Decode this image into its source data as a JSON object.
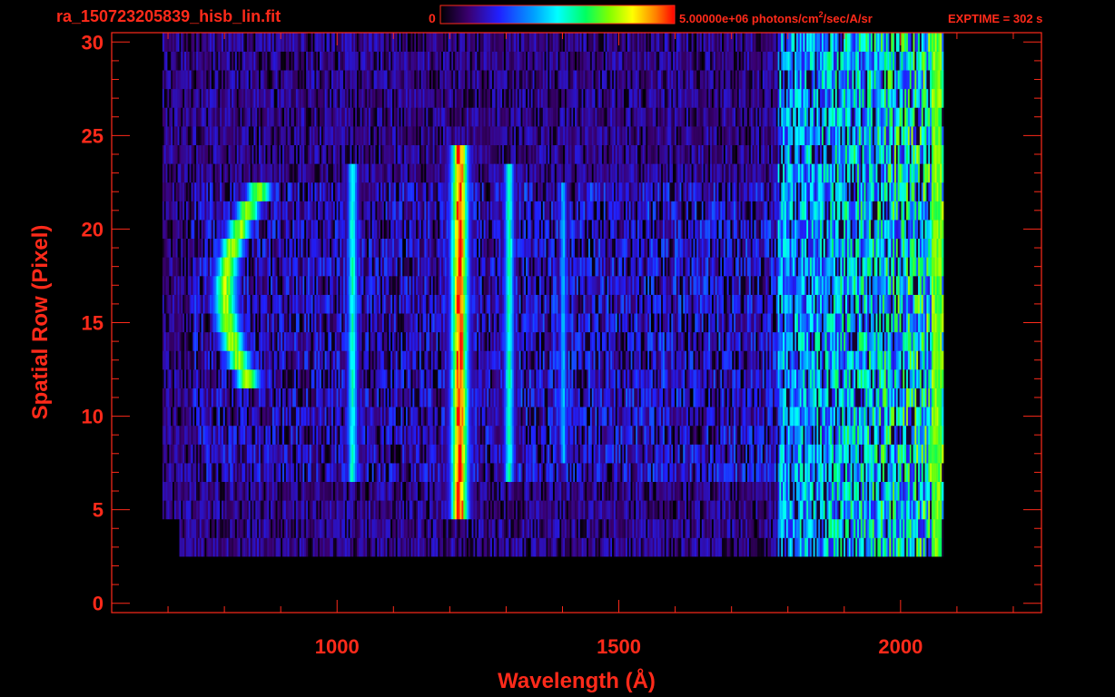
{
  "header": {
    "filename": "ra_150723205839_hisb_lin.fit",
    "colorbar_min": "0",
    "colorbar_max_label": "5.00000e+06 photons/cm",
    "colorbar_sup": "2",
    "colorbar_units_rest": "/sec/A/sr",
    "exptime": "EXPTIME = 302 s"
  },
  "colors": {
    "text": "#ff2a1a",
    "background": "#000000",
    "colormap": [
      "#000000",
      "#3a0070",
      "#2020ff",
      "#00a0ff",
      "#00ffff",
      "#00ff60",
      "#80ff00",
      "#ffff00",
      "#ff8000",
      "#ff0000"
    ]
  },
  "chart_data": {
    "type": "heatmap",
    "title": "",
    "xlabel": "Wavelength (Å)",
    "ylabel": "Spatial Row (Pixel)",
    "xlim": [
      600,
      2250
    ],
    "ylim": [
      -0.5,
      30.5
    ],
    "x_ticks": [
      1000,
      1500,
      2000
    ],
    "y_ticks": [
      0,
      5,
      10,
      15,
      20,
      25,
      30
    ],
    "colorbar_range": [
      0,
      5000000
    ],
    "features": [
      {
        "name": "arc",
        "x": 810,
        "rows": [
          12,
          22
        ],
        "peak": 0.72
      },
      {
        "name": "line_1026",
        "x": 1026,
        "rows": [
          7,
          23
        ],
        "peak": 0.5
      },
      {
        "name": "line_1216",
        "x": 1216,
        "rows": [
          5,
          24
        ],
        "peak": 1.0
      },
      {
        "name": "line_1304",
        "x": 1304,
        "rows": [
          7,
          23
        ],
        "peak": 0.5
      },
      {
        "name": "band_1800_2070",
        "x": [
          1780,
          2070
        ],
        "rows": [
          2,
          30
        ],
        "peak": 0.65
      }
    ]
  }
}
